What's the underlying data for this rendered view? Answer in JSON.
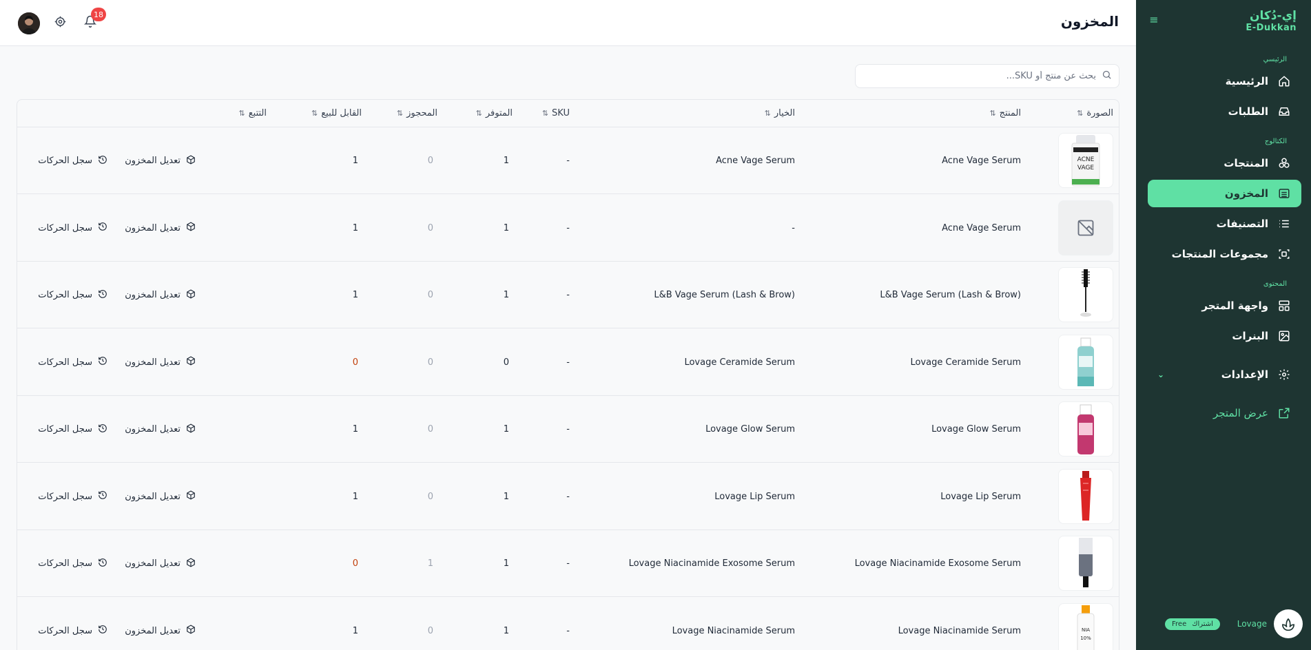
{
  "brand": {
    "arabic": "إي-دُكان",
    "english": "E-Dukkan"
  },
  "sidebar": {
    "sections": {
      "main": "الرئيسي",
      "catalog": "الكتالوج",
      "content": "المحتوى"
    },
    "items": [
      {
        "label": "الرئيسية",
        "icon": "home-icon"
      },
      {
        "label": "الطلبات",
        "icon": "inbox-icon"
      },
      {
        "label": "المنتجات",
        "icon": "boxes-icon"
      },
      {
        "label": "المخزون",
        "icon": "warehouse-icon",
        "active": true
      },
      {
        "label": "التصنيفات",
        "icon": "list-icon"
      },
      {
        "label": "مجموعات المنتجات",
        "icon": "collection-icon"
      },
      {
        "label": "واجهة المتجر",
        "icon": "layout-icon"
      },
      {
        "label": "البنرات",
        "icon": "image-icon"
      },
      {
        "label": "الإعدادات",
        "icon": "gear-icon"
      }
    ],
    "view_store": "عرض المتجر",
    "profile": {
      "name": "Lovage",
      "plan_label": "اشتراك",
      "plan_value": "Free"
    }
  },
  "header": {
    "title": "المخزون",
    "notifications": "18"
  },
  "search": {
    "placeholder": "بحث عن منتج أو SKU..."
  },
  "table": {
    "columns": {
      "image": "الصورة",
      "product": "المنتج",
      "variant": "الخيار",
      "sku": "SKU",
      "available": "المتوفر",
      "reserved": "المحجوز",
      "sellable": "القابل للبيع",
      "tracking": "التتبع"
    },
    "actions": {
      "edit": "تعديل المخزون",
      "history": "سجل الحركات"
    },
    "rows": [
      {
        "product": "Acne Vage Serum",
        "variant": "Acne Vage Serum",
        "sku": "-",
        "available": "1",
        "reserved": "0",
        "sellable": "1",
        "thumb": "acne"
      },
      {
        "product": "Acne Vage Serum",
        "variant": "-",
        "sku": "-",
        "available": "1",
        "reserved": "0",
        "sellable": "1",
        "thumb": "none"
      },
      {
        "product": "L&B Vage Serum (Lash & Brow)",
        "variant": "L&B Vage Serum (Lash & Brow)",
        "sku": "-",
        "available": "1",
        "reserved": "0",
        "sellable": "1",
        "thumb": "lash"
      },
      {
        "product": "Lovage Ceramide Serum",
        "variant": "Lovage Ceramide Serum",
        "sku": "-",
        "available": "0",
        "reserved": "0",
        "sellable": "0",
        "thumb": "ceramide"
      },
      {
        "product": "Lovage Glow Serum",
        "variant": "Lovage Glow Serum",
        "sku": "-",
        "available": "1",
        "reserved": "0",
        "sellable": "1",
        "thumb": "glow"
      },
      {
        "product": "Lovage Lip Serum",
        "variant": "Lovage Lip Serum",
        "sku": "-",
        "available": "1",
        "reserved": "0",
        "sellable": "1",
        "thumb": "lip"
      },
      {
        "product": "Lovage Niacinamide Exosome Serum",
        "variant": "Lovage Niacinamide Exosome Serum",
        "sku": "-",
        "available": "1",
        "reserved": "1",
        "sellable": "0",
        "thumb": "exosome"
      },
      {
        "product": "Lovage Niacinamide Serum",
        "variant": "Lovage Niacinamide Serum",
        "sku": "-",
        "available": "1",
        "reserved": "0",
        "sellable": "1",
        "thumb": "niacinamide"
      }
    ]
  }
}
